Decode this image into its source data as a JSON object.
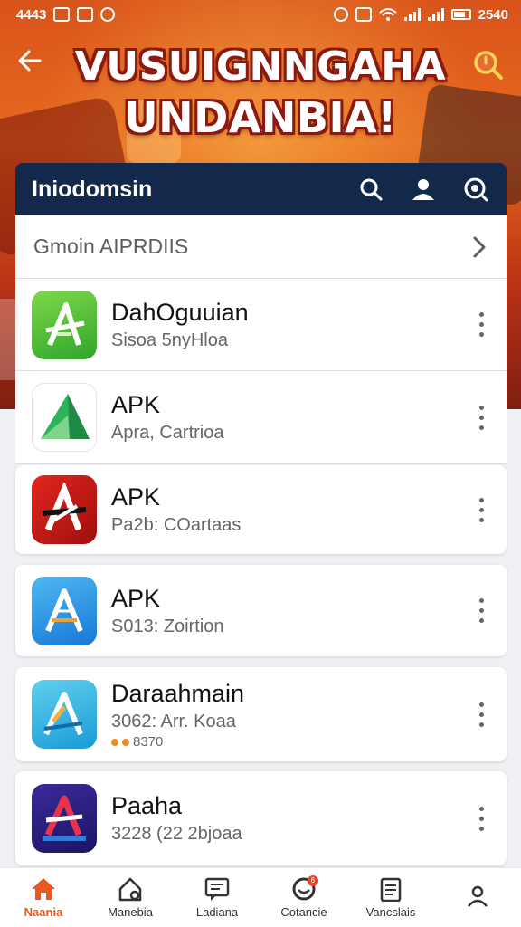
{
  "status_bar": {
    "time_left": "4443",
    "time_right": "2540"
  },
  "hero": {
    "title_line1": "VUSUIGNNGAHA",
    "title_line2": "UNDANBIA!",
    "colors": {
      "primary": "#e66a1f",
      "title_outline": "#8a1a10"
    }
  },
  "app_bar": {
    "title": "Iniodomsin",
    "icons": [
      "search-icon",
      "user-icon",
      "scan-icon"
    ],
    "color": "#13294b"
  },
  "section": {
    "label": "Gmoin AIPRDIIS",
    "icon": "chevron-right-icon"
  },
  "apps": [
    {
      "name": "DahOguuian",
      "sub": "Sisoa 5nyHloa",
      "extra": ""
    },
    {
      "name": "APK",
      "sub": "Apra, Cartrioa",
      "extra": ""
    },
    {
      "name": "APK",
      "sub": "Pa2b: COartaas",
      "extra": ""
    },
    {
      "name": "APK",
      "sub": "S013: Zoirtion",
      "extra": ""
    },
    {
      "name": "Daraahmain",
      "sub": "3062: Arr. Koaa",
      "extra": "8370"
    },
    {
      "name": "Paaha",
      "sub": "3228 (22 2bjoaa",
      "extra": ""
    }
  ],
  "bottom_nav": [
    {
      "label": "Naania",
      "icon": "home-icon",
      "active": true
    },
    {
      "label": "Manebia",
      "icon": "store-icon",
      "active": false
    },
    {
      "label": "Ladiana",
      "icon": "news-icon",
      "active": false
    },
    {
      "label": "Cotancie",
      "icon": "chat-icon",
      "active": false,
      "badge": "6"
    },
    {
      "label": "Vancslais",
      "icon": "clipboard-icon",
      "active": false
    },
    {
      "label": "",
      "icon": "profile-icon",
      "active": false
    }
  ]
}
